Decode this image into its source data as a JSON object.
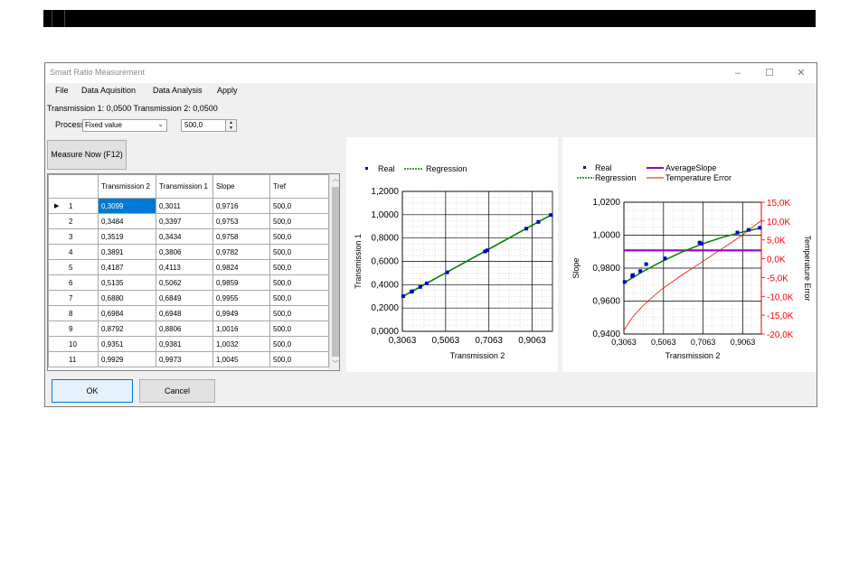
{
  "window": {
    "title": "Smart Ratio Measurement",
    "minimize": "–",
    "maximize": "☐",
    "close": "✕"
  },
  "menu": [
    "File",
    "Data Aquisition",
    "Data Analysis",
    "Apply"
  ],
  "status": "Transmission 1: 0,0500   Transmission 2: 0,0500",
  "process": {
    "label": "Process",
    "selected": "Fixed value",
    "value": "500,0"
  },
  "buttons": {
    "measure": "Measure Now (F12)",
    "ok": "OK",
    "cancel": "Cancel"
  },
  "table": {
    "headers": [
      "Transmission 2",
      "Transmission 1",
      "Slope",
      "Tref"
    ],
    "rows": [
      [
        "1",
        "0,3099",
        "0,3011",
        "0,9716",
        "500,0"
      ],
      [
        "2",
        "0,3484",
        "0,3397",
        "0,9753",
        "500,0"
      ],
      [
        "3",
        "0,3519",
        "0,3434",
        "0,9758",
        "500,0"
      ],
      [
        "4",
        "0,3891",
        "0,3806",
        "0,9782",
        "500,0"
      ],
      [
        "5",
        "0,4187",
        "0,4113",
        "0,9824",
        "500,0"
      ],
      [
        "6",
        "0,5135",
        "0,5062",
        "0,9859",
        "500,0"
      ],
      [
        "7",
        "0,6880",
        "0,6849",
        "0,9955",
        "500,0"
      ],
      [
        "8",
        "0,6984",
        "0,6948",
        "0,9949",
        "500,0"
      ],
      [
        "9",
        "0,8792",
        "0,8806",
        "1,0016",
        "500,0"
      ],
      [
        "10",
        "0,9351",
        "0,9381",
        "1,0032",
        "500,0"
      ],
      [
        "11",
        "0,9929",
        "0,9973",
        "1,0045",
        "500,0"
      ]
    ]
  },
  "chart_data": [
    {
      "type": "scatter",
      "legend": [
        "Real",
        "Regression"
      ],
      "xlabel": "Transmission 2",
      "ylabel": "Transmission 1",
      "xlim": [
        0.3063,
        1.0
      ],
      "ylim": [
        0,
        1.2
      ],
      "xticks": [
        "0,3063",
        "0,5063",
        "0,7063",
        "0,9063"
      ],
      "yticks": [
        "0,0000",
        "0,2000",
        "0,4000",
        "0,6000",
        "0,8000",
        "1,0000",
        "1,2000"
      ],
      "grid": true,
      "legend_position": "top",
      "series": [
        {
          "name": "Real",
          "color": "#0000cc",
          "x": [
            0.3099,
            0.3484,
            0.3519,
            0.3891,
            0.4187,
            0.5135,
            0.688,
            0.6984,
            0.8792,
            0.9351,
            0.9929
          ],
          "y": [
            0.3011,
            0.3397,
            0.3434,
            0.3806,
            0.4113,
            0.5062,
            0.6849,
            0.6948,
            0.8806,
            0.9381,
            0.9973
          ]
        },
        {
          "name": "Regression",
          "color": "#008000",
          "style": "dotted",
          "x": [
            0.3063,
            1.0
          ],
          "y": [
            0.297,
            1.005
          ]
        }
      ]
    },
    {
      "type": "scatter",
      "legend": [
        "Real",
        "AverageSlope",
        "Regression",
        "Temperature Error"
      ],
      "xlabel": "Transmission 2",
      "ylabel": "Slope",
      "y2label": "Temperature Error",
      "xlim": [
        0.3063,
        1.0
      ],
      "ylim": [
        0.94,
        1.02
      ],
      "y2lim": [
        -20,
        15
      ],
      "xticks": [
        "0,3063",
        "0,5063",
        "0,7063",
        "0,9063"
      ],
      "yticks": [
        "0,9400",
        "0,9600",
        "0,9800",
        "1,0000",
        "1,0200"
      ],
      "y2ticks": [
        "-20,0K",
        "-15,0K",
        "-10,0K",
        "-5,0K",
        "0,0K",
        "5,0K",
        "10,0K",
        "15,0K"
      ],
      "grid": true,
      "legend_position": "top",
      "series": [
        {
          "name": "Real",
          "color": "#0000cc",
          "x": [
            0.3099,
            0.3484,
            0.3519,
            0.3891,
            0.4187,
            0.5135,
            0.688,
            0.6984,
            0.8792,
            0.9351,
            0.9929
          ],
          "y": [
            0.9716,
            0.9753,
            0.9758,
            0.9782,
            0.9824,
            0.9859,
            0.9955,
            0.9949,
            1.0016,
            1.0032,
            1.0045
          ]
        },
        {
          "name": "AverageSlope",
          "color": "#9400d3",
          "value": 0.9908
        },
        {
          "name": "Regression",
          "color": "#008000",
          "style": "dotted",
          "x": [
            0.3063,
            0.4,
            0.5,
            0.6,
            0.7,
            0.8,
            0.9,
            1.0
          ],
          "y": [
            0.971,
            0.9778,
            0.9842,
            0.9898,
            0.9946,
            0.9986,
            1.0018,
            1.0045
          ]
        },
        {
          "name": "Temperature Error",
          "color": "#ff0000",
          "axis": "y2",
          "x": [
            0.3063,
            0.35,
            0.4,
            0.45,
            0.5,
            0.6,
            0.7,
            0.8,
            0.9,
            1.0
          ],
          "y": [
            -19,
            -15.5,
            -12.6,
            -10.2,
            -8.0,
            -4.3,
            -0.9,
            2.6,
            6.1,
            10.2
          ]
        }
      ]
    }
  ]
}
